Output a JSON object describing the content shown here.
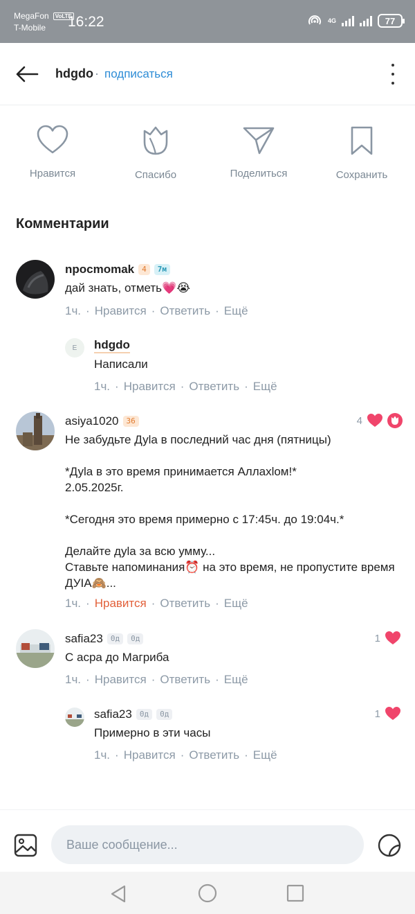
{
  "status_bar": {
    "carrier1": "MegaFon",
    "volte": "VoLTE",
    "carrier2": "T-Mobile",
    "time": "16:22",
    "network": "4G",
    "battery": "77"
  },
  "header": {
    "username": "hdgdo",
    "dot": "·",
    "subscribe": "подписаться"
  },
  "actions": [
    {
      "label": "Нравится",
      "icon": "heart-icon"
    },
    {
      "label": "Спасибо",
      "icon": "tulip-icon"
    },
    {
      "label": "Поделиться",
      "icon": "send-icon"
    },
    {
      "label": "Сохранить",
      "icon": "bookmark-icon"
    }
  ],
  "comments_title": "Комментарии",
  "meta": {
    "like": "Нравится",
    "reply": "Ответить",
    "more": "Ещё",
    "sep": "·"
  },
  "comments": [
    {
      "username": "npocmomak",
      "badges": [
        "4",
        "7м"
      ],
      "text": "дай знать, отметь💗😭",
      "time": "1ч."
    },
    {
      "username": "hdgdo",
      "avatar_letter": "E",
      "text": "Написали",
      "time": "1ч."
    },
    {
      "username": "asiya1020",
      "badges": [
        "36"
      ],
      "text": "Не забудьте Дуlа в последний час дня (пятницы)\n\n*Дуlа в это время принимается Аллахlом!*\n2.05.2025г.\n\n*Сегодня это время примерно с 17:45ч. до 19:04ч.*\n\n Делайте дуlа за всю умму...\n Ставьте напоминания⏰ на это время, не пропустите время ДУIА🙈...",
      "time": "1ч.",
      "likes": "4"
    },
    {
      "username": "safia23",
      "badges": [
        "0д",
        "0д"
      ],
      "text": "С асра до Магриба",
      "time": "1ч.",
      "likes": "1"
    },
    {
      "username": "safia23",
      "badges": [
        "0д",
        "0д"
      ],
      "text": "Примерно в эти часы",
      "time": "1ч.",
      "likes": "1"
    }
  ],
  "composer": {
    "placeholder": "Ваше сообщение..."
  },
  "colors": {
    "accent": "#2d8cd6",
    "liked": "#e2603a",
    "heart": "#f0456b"
  }
}
